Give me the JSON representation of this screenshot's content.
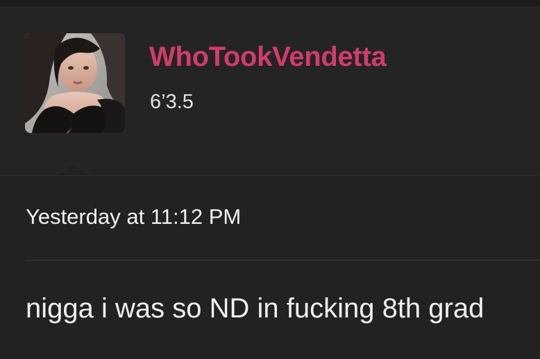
{
  "profile": {
    "username": "WhoTookVendetta",
    "user_title": "6’3.5",
    "avatar_icon": "user-avatar-photo"
  },
  "post": {
    "timestamp": "Yesterday at 11:12 PM",
    "message": "nigga i was so ND in fucking 8th grad"
  },
  "colors": {
    "background": "#232324",
    "username": "#d23c69",
    "text": "#f0f0f2",
    "divider": "#38383a"
  }
}
